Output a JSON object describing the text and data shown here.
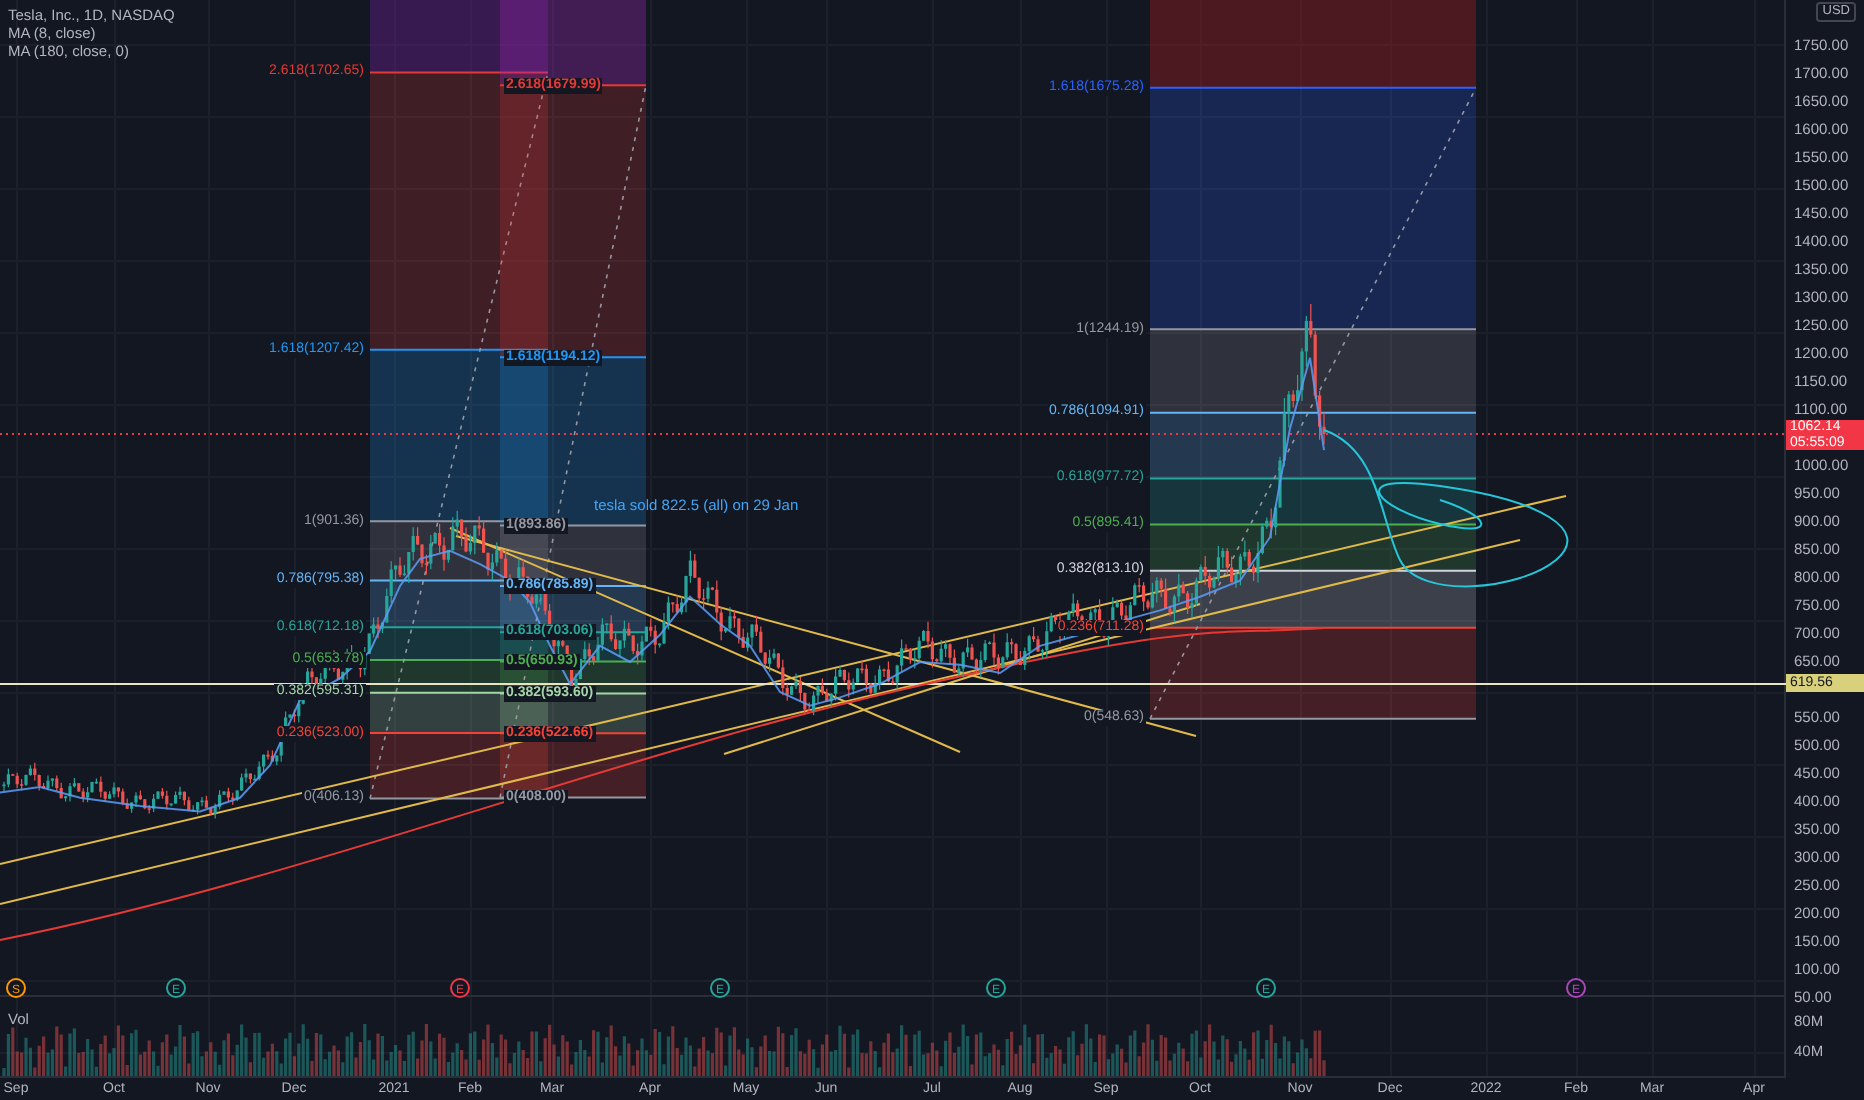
{
  "legend": {
    "title": "Tesla, Inc., 1D, NASDAQ",
    "indicators": [
      "MA (8, close)",
      "MA (180, close, 0)"
    ]
  },
  "fib_retracements": [
    {
      "levels": [
        {
          "label": "2.618(1702.65)",
          "color": "#e53935"
        },
        {
          "label": "1.618(1207.42)",
          "color": "#2196f3"
        },
        {
          "label": "1(901.36)",
          "color": "#9598a1"
        },
        {
          "label": "0.786(795.38)",
          "color": "#64b5f6"
        },
        {
          "label": "0.618(712.18)",
          "color": "#26a69a"
        },
        {
          "label": "0.5(653.78)",
          "color": "#4caf50"
        },
        {
          "label": "0.382(595.31)",
          "color": "#a5d6a7"
        },
        {
          "label": "0.236(523.00)",
          "color": "#f44336"
        },
        {
          "label": "0(406.13)",
          "color": "#9598a1"
        }
      ]
    },
    {
      "levels": [
        {
          "label": "2.618(1679.99)"
        },
        {
          "label": "1.618(1194.12)"
        },
        {
          "label": "1(893.86)"
        },
        {
          "label": "0.786(785.89)"
        },
        {
          "label": "0.618(703.06)"
        },
        {
          "label": "0.5(650.93)"
        },
        {
          "label": "0.382(593.60)"
        },
        {
          "label": "0.236(522.66)"
        },
        {
          "label": "0(408.00)"
        }
      ]
    },
    {
      "levels": [
        {
          "label": "1.618(1675.28)",
          "color": "#2962ff"
        },
        {
          "label": "1(1244.19)",
          "color": "#9598a1"
        },
        {
          "label": "0.786(1094.91)",
          "color": "#64b5f6"
        },
        {
          "label": "0.618(977.72)",
          "color": "#26a69a"
        },
        {
          "label": "0.5(895.41)",
          "color": "#4caf50"
        },
        {
          "label": "0.382(813.10)",
          "color": "#d1d4dc"
        },
        {
          "label": "0.236(711.28)",
          "color": "#f44336"
        },
        {
          "label": "0(548.63)",
          "color": "#9598a1"
        }
      ]
    }
  ],
  "annotation": "tesla sold 822.5 (all) on 29 Jan",
  "event_markers": [
    {
      "letter": "S",
      "color": "#ff9800"
    },
    {
      "letter": "E",
      "color": "#26a69a"
    },
    {
      "letter": "E",
      "color": "#f23645"
    },
    {
      "letter": "E",
      "color": "#26a69a"
    },
    {
      "letter": "E",
      "color": "#26a69a"
    },
    {
      "letter": "E",
      "color": "#26a69a"
    },
    {
      "letter": "E",
      "color": "#ab47bc"
    }
  ],
  "volume_pane": {
    "label": "Vol"
  },
  "price_axis": {
    "currency": "USD",
    "ticks": [
      "1750.00",
      "1700.00",
      "1650.00",
      "1600.00",
      "1550.00",
      "1500.00",
      "1450.00",
      "1400.00",
      "1350.00",
      "1300.00",
      "1250.00",
      "1200.00",
      "1150.00",
      "1100.00",
      "1000.00",
      "950.00",
      "900.00",
      "850.00",
      "800.00",
      "750.00",
      "700.00",
      "650.00",
      "550.00",
      "500.00",
      "450.00",
      "400.00",
      "350.00",
      "300.00",
      "250.00",
      "200.00",
      "150.00",
      "100.00",
      "50.00"
    ],
    "last_price_tag": {
      "price": "1062.14",
      "countdown": "05:55:09"
    },
    "level_tag": "619.56"
  },
  "volume_axis": {
    "ticks": [
      "80M",
      "40M"
    ]
  },
  "time_axis": {
    "ticks": [
      "Sep",
      "Oct",
      "Nov",
      "Dec",
      "2021",
      "Feb",
      "Mar",
      "Apr",
      "May",
      "Jun",
      "Jul",
      "Aug",
      "Sep",
      "Oct",
      "Nov",
      "Dec",
      "2022",
      "Feb",
      "Mar",
      "Apr"
    ]
  }
}
